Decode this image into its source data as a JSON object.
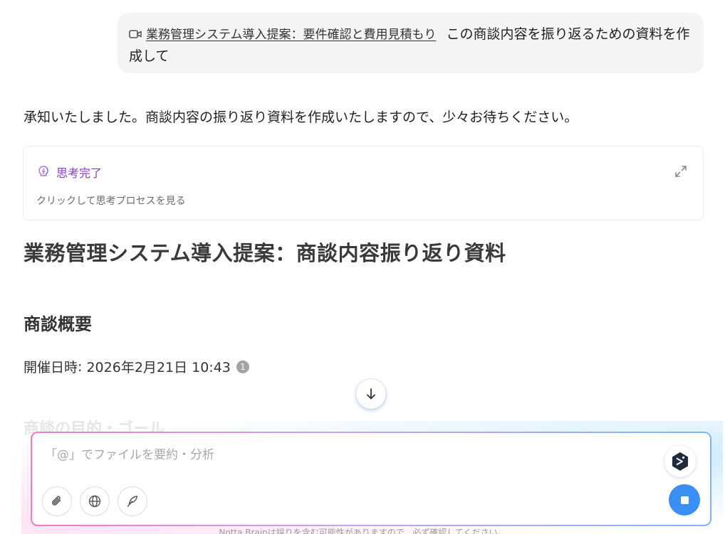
{
  "user_message": {
    "reference_title": "業務管理システム導入提案：要件確認と費用見積もり",
    "text": "この商談内容を振り返るための資料を作成して"
  },
  "assistant": {
    "reply": "承知いたしました。商談内容の振り返り資料を作成いたしますので、少々お待ちください。",
    "thinking": {
      "status": "思考完了",
      "hint": "クリックして思考プロセスを見る"
    },
    "document": {
      "title": "業務管理システム導入提案：商談内容振り返り資料",
      "section_title": "商談概要",
      "meeting_label": "開催日時",
      "meeting_separator": ": ",
      "meeting_value": "2026年2月21日 10:43",
      "citation": "1",
      "next_section_faded": "商談の目的・ゴール"
    }
  },
  "composer": {
    "placeholder": "「@」でファイルを要約・分析"
  },
  "disclaimer": "Notta Brainは誤りを含む可能性がありますので、必ず確認してください。",
  "colors": {
    "accent": "#3b8ef2",
    "thinking_label": "#8a3ac8",
    "bubble_bg": "#f4f4f4"
  },
  "icons": {
    "reference": "video-icon",
    "thinking": "lightbulb-icon",
    "expand": "expand-icon",
    "scroll": "arrow-down-icon",
    "attach": "paperclip-icon",
    "web": "globe-icon",
    "style": "feather-icon",
    "stop": "stop-icon",
    "assistant": "assistant-logo-icon"
  }
}
